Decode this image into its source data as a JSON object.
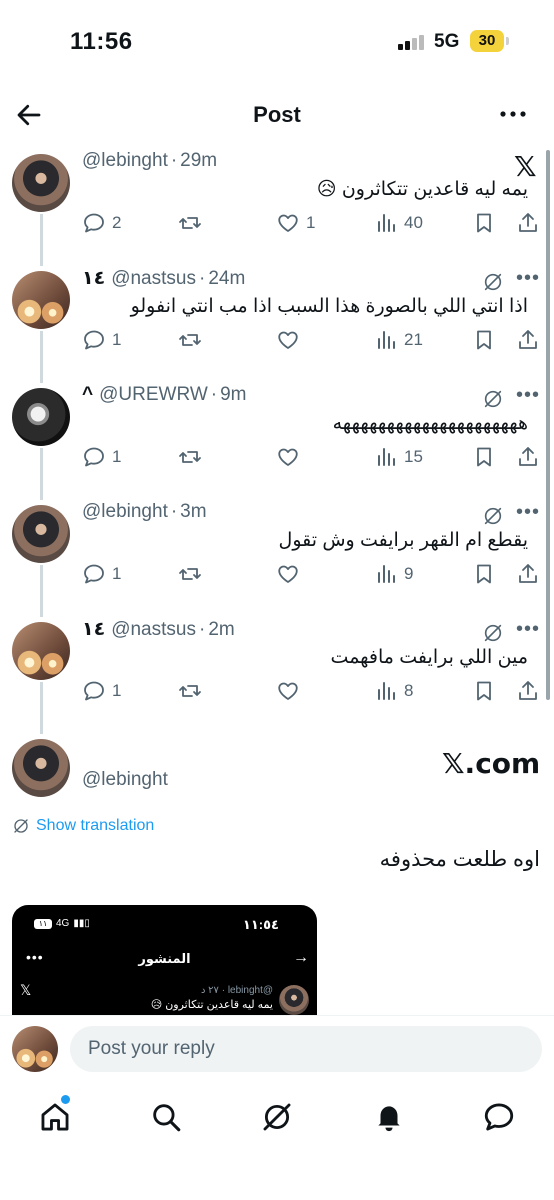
{
  "status": {
    "time": "11:56",
    "network": "5G",
    "battery": "30"
  },
  "header": {
    "title": "Post"
  },
  "replies": [
    {
      "badge": "",
      "handle": "@lebinght",
      "time": "29m",
      "text": "يمه ليه قاعدين تتكاثرون 😥",
      "counts": {
        "replies": "2",
        "retweets": "",
        "likes": "1",
        "views": "40"
      },
      "corner": "x"
    },
    {
      "badge": "١٤",
      "handle": "@nastsus",
      "time": "24m",
      "text": "اذا انتي اللي بالصورة هذا السبب اذا مب انتي انفولو",
      "counts": {
        "replies": "1",
        "retweets": "",
        "likes": "",
        "views": "21"
      },
      "corner": "grok"
    },
    {
      "badge": "^",
      "handle": "@UREWRW",
      "time": "9m",
      "text": "هههههههههههههههههههههه",
      "counts": {
        "replies": "1",
        "retweets": "",
        "likes": "",
        "views": "15"
      },
      "corner": "grok"
    },
    {
      "badge": "",
      "handle": "@lebinght",
      "time": "3m",
      "text": "يقطع ام القهر برايفت وش تقول",
      "counts": {
        "replies": "1",
        "retweets": "",
        "likes": "",
        "views": "9"
      },
      "corner": "grok"
    },
    {
      "badge": "١٤",
      "handle": "@nastsus",
      "time": "2m",
      "text": "مين اللي برايفت مافهمت",
      "counts": {
        "replies": "1",
        "retweets": "",
        "likes": "",
        "views": "8"
      },
      "corner": "grok"
    }
  ],
  "main_post": {
    "handle": "@lebinght",
    "brand": "𝕏.com",
    "show_translation": "Show translation",
    "text": "اوه طلعت محذوفه"
  },
  "media": {
    "time": "١١:٥٤",
    "network": "4G",
    "battery": "١١",
    "title": "المنشور",
    "user_meta": "@lebinght · ٢٧ د",
    "text": "يمه ليه قاعدين تتكاثرون 😥"
  },
  "reply_bar": {
    "placeholder": "Post your reply"
  },
  "icons": {
    "x_logo": "𝕏",
    "more": "•••",
    "reply": "speech-bubble",
    "retweet": "retweet-arrows",
    "like": "heart",
    "views": "bar-chart",
    "bookmark": "bookmark",
    "share": "upload-arrow"
  },
  "colors": {
    "accent": "#1d9bf0",
    "muted": "#536471",
    "text": "#0f1419",
    "line": "#cfd9de"
  }
}
